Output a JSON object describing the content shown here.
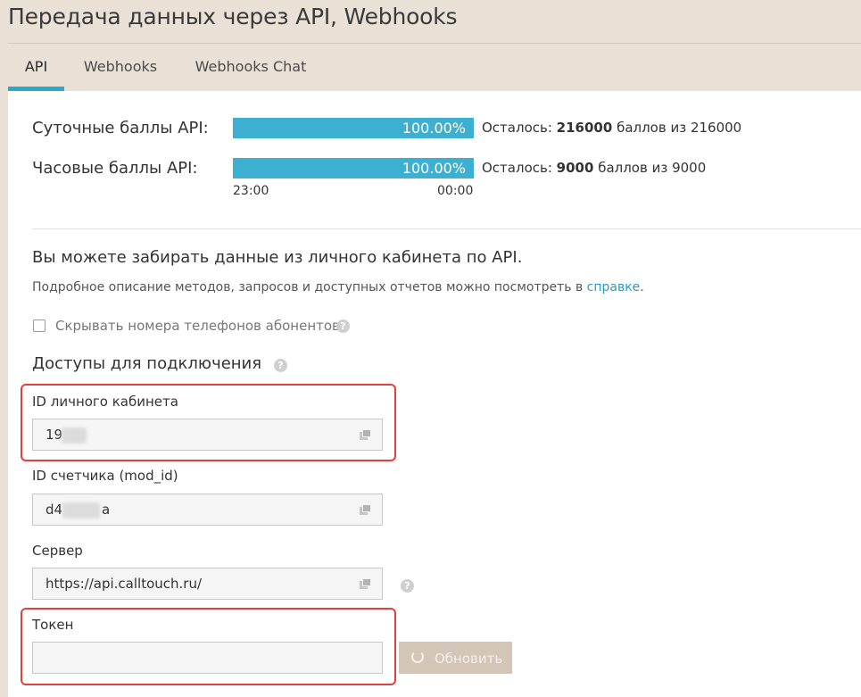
{
  "page": {
    "title": "Передача данных через API, Webhooks"
  },
  "tabs": [
    {
      "label": "API",
      "active": true
    },
    {
      "label": "Webhooks",
      "active": false
    },
    {
      "label": "Webhooks Chat",
      "active": false
    }
  ],
  "limits": {
    "daily": {
      "label": "Суточные баллы API:",
      "percent": "100.00%",
      "fill_fraction": 1.0,
      "remaining_prefix": "Осталось: ",
      "remaining_value": "216000",
      "remaining_suffix": " баллов из 216000"
    },
    "hourly": {
      "label": "Часовые баллы API:",
      "percent": "100.00%",
      "fill_fraction": 1.0,
      "remaining_prefix": "Осталось: ",
      "remaining_value": "9000",
      "remaining_suffix": " баллов из 9000",
      "time_start": "23:00",
      "time_end": "00:00"
    }
  },
  "intro": {
    "heading": "Вы можете забирать данные из личного кабинета по API.",
    "desc_text": "Подробное описание методов, запросов и доступных отчетов можно посмотреть в ",
    "desc_link": "справке",
    "desc_end": "."
  },
  "hide_phones": {
    "label": "Скрывать номера телефонов абонентов",
    "checked": false
  },
  "access": {
    "title": "Доступы для подключения",
    "cabinet_id": {
      "label": "ID личного кабинета",
      "value": "19"
    },
    "mod_id": {
      "label": "ID счетчика (mod_id)",
      "value_start": "d4",
      "value_end": "a"
    },
    "server": {
      "label": "Сервер",
      "value": "https://api.calltouch.ru/"
    },
    "token": {
      "label": "Токен",
      "value": ""
    },
    "refresh_label": "Обновить"
  },
  "colors": {
    "accent": "#2ea8c8",
    "bar": "#3db0d2",
    "link": "#2e9ac2",
    "highlight": "#e0413a",
    "background": "#e9e0d6",
    "button_disabled": "#d3c6b7"
  },
  "icons": [
    "help-icon",
    "copy-icon",
    "refresh-icon"
  ]
}
